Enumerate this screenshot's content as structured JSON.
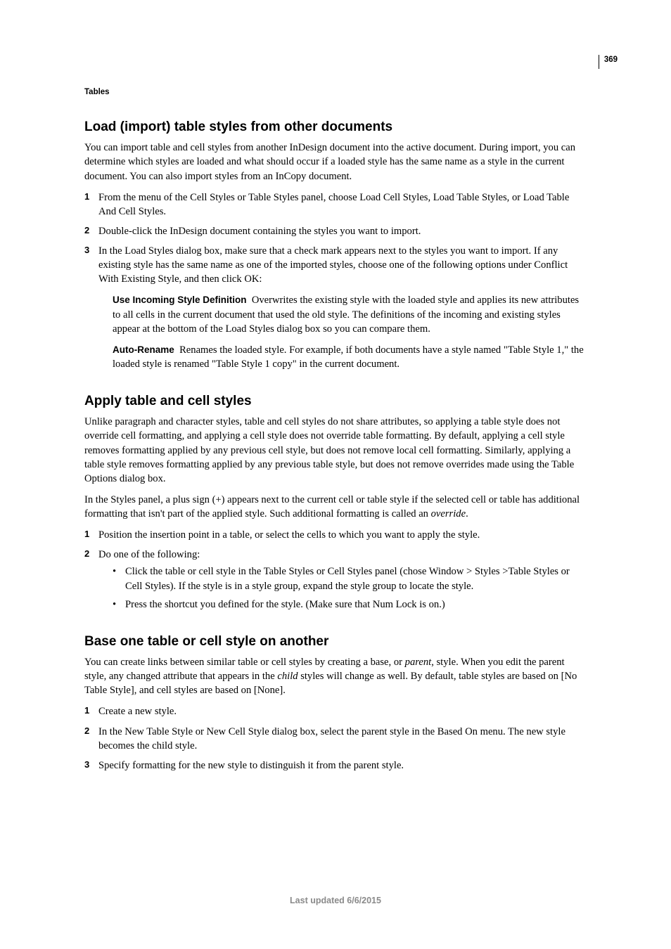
{
  "page_number": "369",
  "chapter_label": "Tables",
  "footer": "Last updated 6/6/2015",
  "sec1": {
    "title": "Load (import) table styles from other documents",
    "intro": "You can import table and cell styles from another InDesign document into the active document. During import, you can determine which styles are loaded and what should occur if a loaded style has the same name as a style in the current document. You can also import styles from an InCopy document.",
    "step1": "From the menu of the Cell Styles or Table Styles panel, choose Load Cell Styles, Load Table Styles, or Load Table And Cell Styles.",
    "step2": "Double-click the InDesign document containing the styles you want to import.",
    "step3": "In the Load Styles dialog box, make sure that a check mark appears next to the styles you want to import. If any existing style has the same name as one of the imported styles, choose one of the following options under Conflict With Existing Style, and then click OK:",
    "def1_label": "Use Incoming Style Definition",
    "def1_body": "Overwrites the existing style with the loaded style and applies its new attributes to all cells in the current document that used the old style. The definitions of the incoming and existing styles appear at the bottom of the Load Styles dialog box so you can compare them.",
    "def2_label": "Auto-Rename",
    "def2_body": "Renames the loaded style. For example, if both documents have a style named \"Table Style 1,\" the loaded style is renamed \"Table Style 1 copy\" in the current document."
  },
  "sec2": {
    "title": "Apply table and cell styles",
    "para1": "Unlike paragraph and character styles, table and cell styles do not share attributes, so applying a table style does not override cell formatting, and applying a cell style does not override table formatting. By default, applying a cell style removes formatting applied by any previous cell style, but does not remove local cell formatting. Similarly, applying a table style removes formatting applied by any previous table style, but does not remove overrides made using the Table Options dialog box.",
    "para2_pre": "In the Styles panel, a plus sign (+) appears next to the current cell or table style if the selected cell or table has additional formatting that isn't part of the applied style. Such additional formatting is called an ",
    "para2_em": "override",
    "para2_post": ".",
    "step1": "Position the insertion point in a table, or select the cells to which you want to apply the style.",
    "step2": "Do one of the following:",
    "bullet1": "Click the table or cell style in the Table Styles or Cell Styles panel (chose Window > Styles >Table Styles or Cell Styles). If the style is in a style group, expand the style group to locate the style.",
    "bullet2": "Press the shortcut you defined for the style. (Make sure that Num Lock is on.)"
  },
  "sec3": {
    "title": "Base one table or cell style on another",
    "para1_pre": "You can create links between similar table or cell styles by creating a base, or ",
    "para1_em1": "parent",
    "para1_mid": ", style. When you edit the parent style, any changed attribute that appears in the ",
    "para1_em2": "child",
    "para1_post": " styles will change as well. By default, table styles are based on [No Table Style], and cell styles are based on [None].",
    "step1": "Create a new style.",
    "step2": "In the New Table Style or New Cell Style dialog box, select the parent style in the Based On menu. The new style becomes the child style.",
    "step3": "Specify formatting for the new style to distinguish it from the parent style."
  }
}
